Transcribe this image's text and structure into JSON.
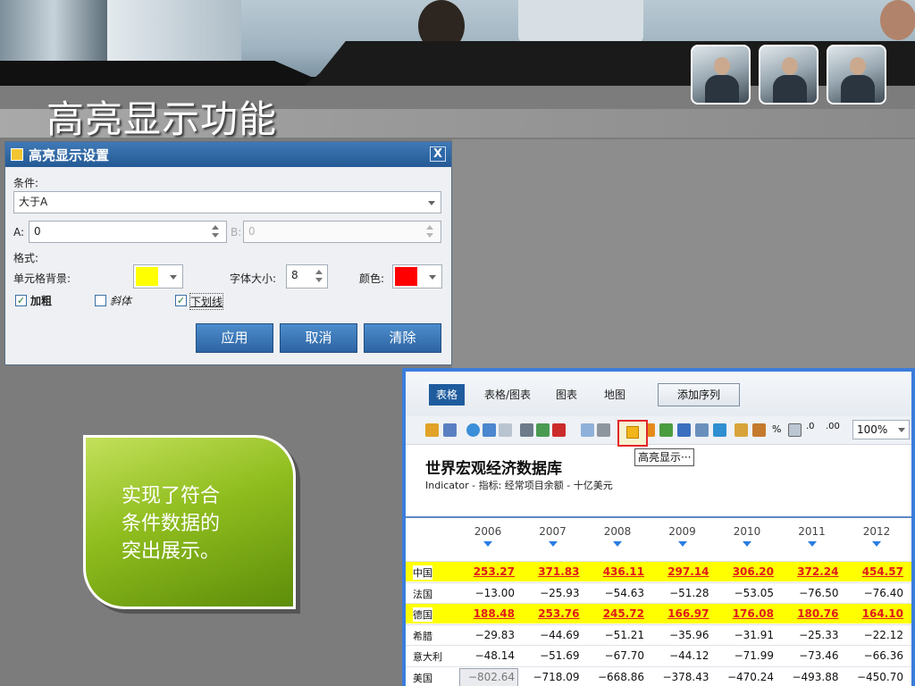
{
  "slide": {
    "title": "高亮显示功能",
    "note_text": "实现了符合\n条件数据的\n突出展示。"
  },
  "dialog": {
    "title": "高亮显示设置",
    "close_label": "X",
    "condition_label": "条件:",
    "condition_value": "大于A",
    "a_label": "A:",
    "a_value": "0",
    "b_label": "B:",
    "b_value": "0",
    "format_label": "格式:",
    "cell_bg_label": "单元格背景:",
    "cell_bg_color": "#ffff00",
    "font_size_label": "字体大小:",
    "font_size_value": "8",
    "color_label": "颜色:",
    "font_color": "#ff0000",
    "bold_label": "加粗",
    "bold_checked": true,
    "italic_label": "斜体",
    "italic_checked": false,
    "underline_label": "下划线",
    "underline_checked": true,
    "apply_label": "应用",
    "cancel_label": "取消",
    "clear_label": "清除"
  },
  "data_window": {
    "tabs": [
      "表格",
      "表格/图表",
      "图表",
      "地图"
    ],
    "active_tab": "表格",
    "add_series_label": "添加序列",
    "zoom": "100%",
    "tooltip": "高亮显示···",
    "db_title": "世界宏观经济数据库",
    "db_subtitle": "Indicator - 指标: 经常项目余额 - 十亿美元",
    "years": [
      "2006",
      "2007",
      "2008",
      "2009",
      "2010",
      "2011",
      "2012"
    ],
    "rows": [
      {
        "label": "中国",
        "values": [
          "253.27",
          "371.83",
          "436.11",
          "297.14",
          "306.20",
          "372.24",
          "454.57"
        ],
        "highlighted": true
      },
      {
        "label": "法国",
        "values": [
          "−13.00",
          "−25.93",
          "−54.63",
          "−51.28",
          "−53.05",
          "−76.50",
          "−76.40"
        ],
        "highlighted": false
      },
      {
        "label": "德国",
        "values": [
          "188.48",
          "253.76",
          "245.72",
          "166.97",
          "176.08",
          "180.76",
          "164.10"
        ],
        "highlighted": true
      },
      {
        "label": "希腊",
        "values": [
          "−29.83",
          "−44.69",
          "−51.21",
          "−35.96",
          "−31.91",
          "−25.33",
          "−22.12"
        ],
        "highlighted": false
      },
      {
        "label": "意大利",
        "values": [
          "−48.14",
          "−51.69",
          "−67.70",
          "−44.12",
          "−71.99",
          "−73.46",
          "−66.36"
        ],
        "highlighted": false
      },
      {
        "label": "美国",
        "values": [
          "−802.64",
          "−718.09",
          "−668.86",
          "−378.43",
          "−470.24",
          "−493.88",
          "−450.70"
        ],
        "highlighted": false
      }
    ],
    "highlight_bg": "#ffff00",
    "highlight_fg": "#e01b1b"
  }
}
